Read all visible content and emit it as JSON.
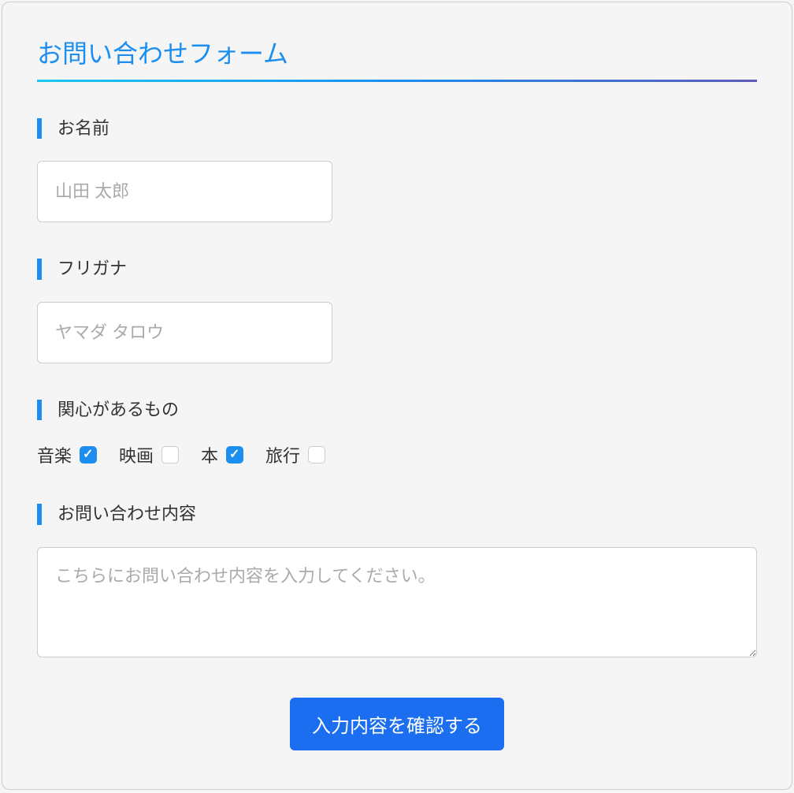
{
  "form": {
    "title": "お問い合わせフォーム",
    "fields": {
      "name": {
        "label": "お名前",
        "placeholder": "山田 太郎",
        "value": ""
      },
      "furigana": {
        "label": "フリガナ",
        "placeholder": "ヤマダ タロウ",
        "value": ""
      },
      "interests": {
        "label": "関心があるもの",
        "options": [
          {
            "label": "音楽",
            "checked": true
          },
          {
            "label": "映画",
            "checked": false
          },
          {
            "label": "本",
            "checked": true
          },
          {
            "label": "旅行",
            "checked": false
          }
        ]
      },
      "inquiry": {
        "label": "お問い合わせ内容",
        "placeholder": "こちらにお問い合わせ内容を入力してください。",
        "value": ""
      }
    },
    "submit_label": "入力内容を確認する"
  }
}
